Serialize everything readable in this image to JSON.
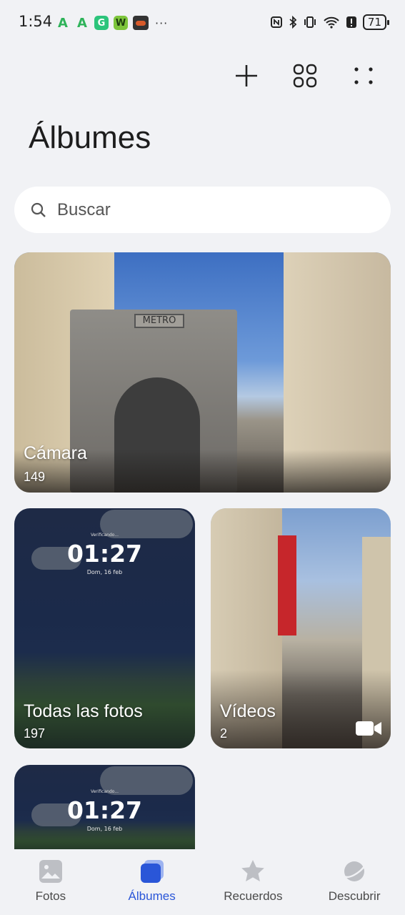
{
  "status_bar": {
    "time": "1:54",
    "notifications": [
      "A",
      "A",
      "G",
      "W",
      "",
      "···"
    ],
    "battery": "71"
  },
  "header": {
    "title": "Álbumes",
    "actions": {
      "add_icon": "plus-icon",
      "grid_icon": "grid-icon",
      "more_icon": "more-icon"
    }
  },
  "search": {
    "placeholder": "Buscar",
    "icon": "search-icon"
  },
  "albums": [
    {
      "name": "Cámara",
      "count": "149",
      "sign": "METRO"
    },
    {
      "name": "Todas las fotos",
      "count": "197",
      "lock_time": "01:27",
      "lock_date": "Dom, 16 feb",
      "lock_verify": "Verificando..."
    },
    {
      "name": "Vídeos",
      "count": "2",
      "icon": "video-camera-icon"
    },
    {
      "name": "",
      "count": "",
      "lock_time": "01:27",
      "lock_date": "Dom, 16 feb",
      "lock_verify": "Verificando..."
    }
  ],
  "bottom_nav": {
    "items": [
      {
        "label": "Fotos",
        "icon": "photo-icon"
      },
      {
        "label": "Álbumes",
        "icon": "albums-icon",
        "active": true
      },
      {
        "label": "Recuerdos",
        "icon": "star-icon"
      },
      {
        "label": "Descubrir",
        "icon": "planet-icon"
      }
    ],
    "active_color": "#2a56d8"
  }
}
